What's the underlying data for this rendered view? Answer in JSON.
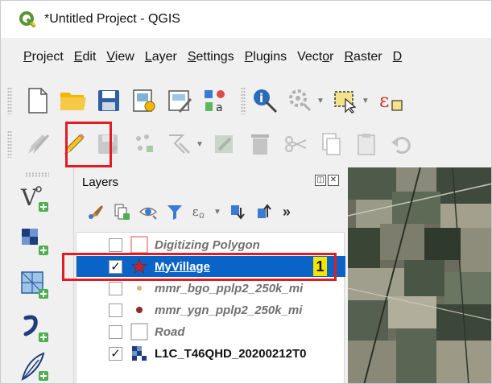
{
  "window": {
    "title": "*Untitled Project - QGIS"
  },
  "menubar": {
    "items": [
      {
        "pre": "",
        "ul": "P",
        "post": "roject"
      },
      {
        "pre": "",
        "ul": "E",
        "post": "dit"
      },
      {
        "pre": "",
        "ul": "V",
        "post": "iew"
      },
      {
        "pre": "",
        "ul": "L",
        "post": "ayer"
      },
      {
        "pre": "",
        "ul": "S",
        "post": "ettings"
      },
      {
        "pre": "",
        "ul": "P",
        "post": "lugins"
      },
      {
        "pre": "Vect",
        "ul": "o",
        "post": "r"
      },
      {
        "pre": "",
        "ul": "R",
        "post": "aster"
      },
      {
        "pre": "",
        "ul": "D",
        "post": ""
      }
    ]
  },
  "toolbar_file": {
    "icons": [
      "new-project-icon",
      "open-project-icon",
      "save-project-icon",
      "new-print-layout-icon",
      "layout-manager-icon",
      "style-manager-icon",
      "identify-features-icon",
      "run-action-icon",
      "select-features-icon",
      "expression-select-icon"
    ]
  },
  "toolbar_digitizing": {
    "icons": [
      "current-edits-icon",
      "toggle-editing-icon",
      "save-layer-edits-icon",
      "add-point-feature-icon",
      "vertex-tool-icon",
      "modify-attributes-icon",
      "delete-selected-icon",
      "cut-features-icon",
      "copy-features-icon",
      "paste-features-icon",
      "undo-icon"
    ]
  },
  "left_toolbar": {
    "icons": [
      "add-vector-layer-icon",
      "add-raster-layer-icon",
      "add-mesh-layer-icon",
      "add-delimited-text-icon",
      "add-spatialite-icon"
    ]
  },
  "layers_panel": {
    "title": "Layers",
    "tools": [
      "open-layer-styling-icon",
      "add-group-icon",
      "manage-visibility-icon",
      "filter-legend-icon",
      "filter-by-expression-icon",
      "expand-all-icon",
      "collapse-all-icon"
    ],
    "more": "»",
    "layers": [
      {
        "name": "Digitizing Polygon",
        "checked": false,
        "style": "italic",
        "symbol": "polygon-empty"
      },
      {
        "name": "MyVillage",
        "checked": true,
        "style": "selected",
        "symbol": "point-star",
        "badge": "1"
      },
      {
        "name": "mmr_bgo_pplp2_250k_mi",
        "checked": false,
        "style": "italic",
        "symbol": "point-small-tan"
      },
      {
        "name": "mmr_ygn_pplp2_250k_mi",
        "checked": false,
        "style": "italic",
        "symbol": "point-dark-red"
      },
      {
        "name": "Road",
        "checked": false,
        "style": "italic",
        "symbol": "polygon-empty-gray"
      },
      {
        "name": "L1C_T46QHD_20200212T0",
        "checked": true,
        "style": "bold",
        "symbol": "raster"
      }
    ]
  },
  "colors": {
    "accent_red": "#e31b23",
    "selection_blue": "#0a64c8",
    "badge_yellow": "#f2e600",
    "qgis_green": "#589632"
  }
}
